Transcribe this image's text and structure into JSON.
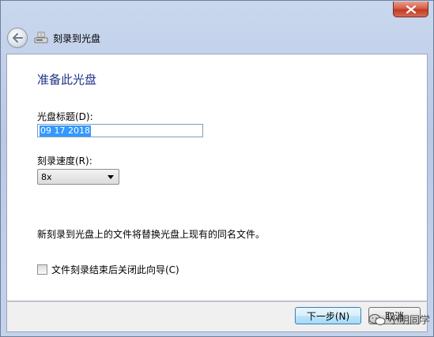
{
  "window": {
    "title": "刻录到光盘"
  },
  "header": {
    "title": "刻录到光盘"
  },
  "page": {
    "title": "准备此光盘",
    "disc_title_label": "光盘标题(D):",
    "disc_title_value": "09 17 2018",
    "speed_label": "刻录速度(R):",
    "speed_value": "8x",
    "notice": "新刻录到光盘上的文件将替换光盘上现有的同名文件。",
    "close_wizard_checkbox_label": "文件刻录结束后关闭此向导(C)",
    "close_wizard_checked": false
  },
  "buttons": {
    "next": "下一步(N)",
    "cancel": "取消"
  },
  "watermark": {
    "text": "小明同学"
  },
  "colors": {
    "title_blue": "#1e3287",
    "close_red": "#c13a22",
    "selection_blue": "#3399ff"
  }
}
